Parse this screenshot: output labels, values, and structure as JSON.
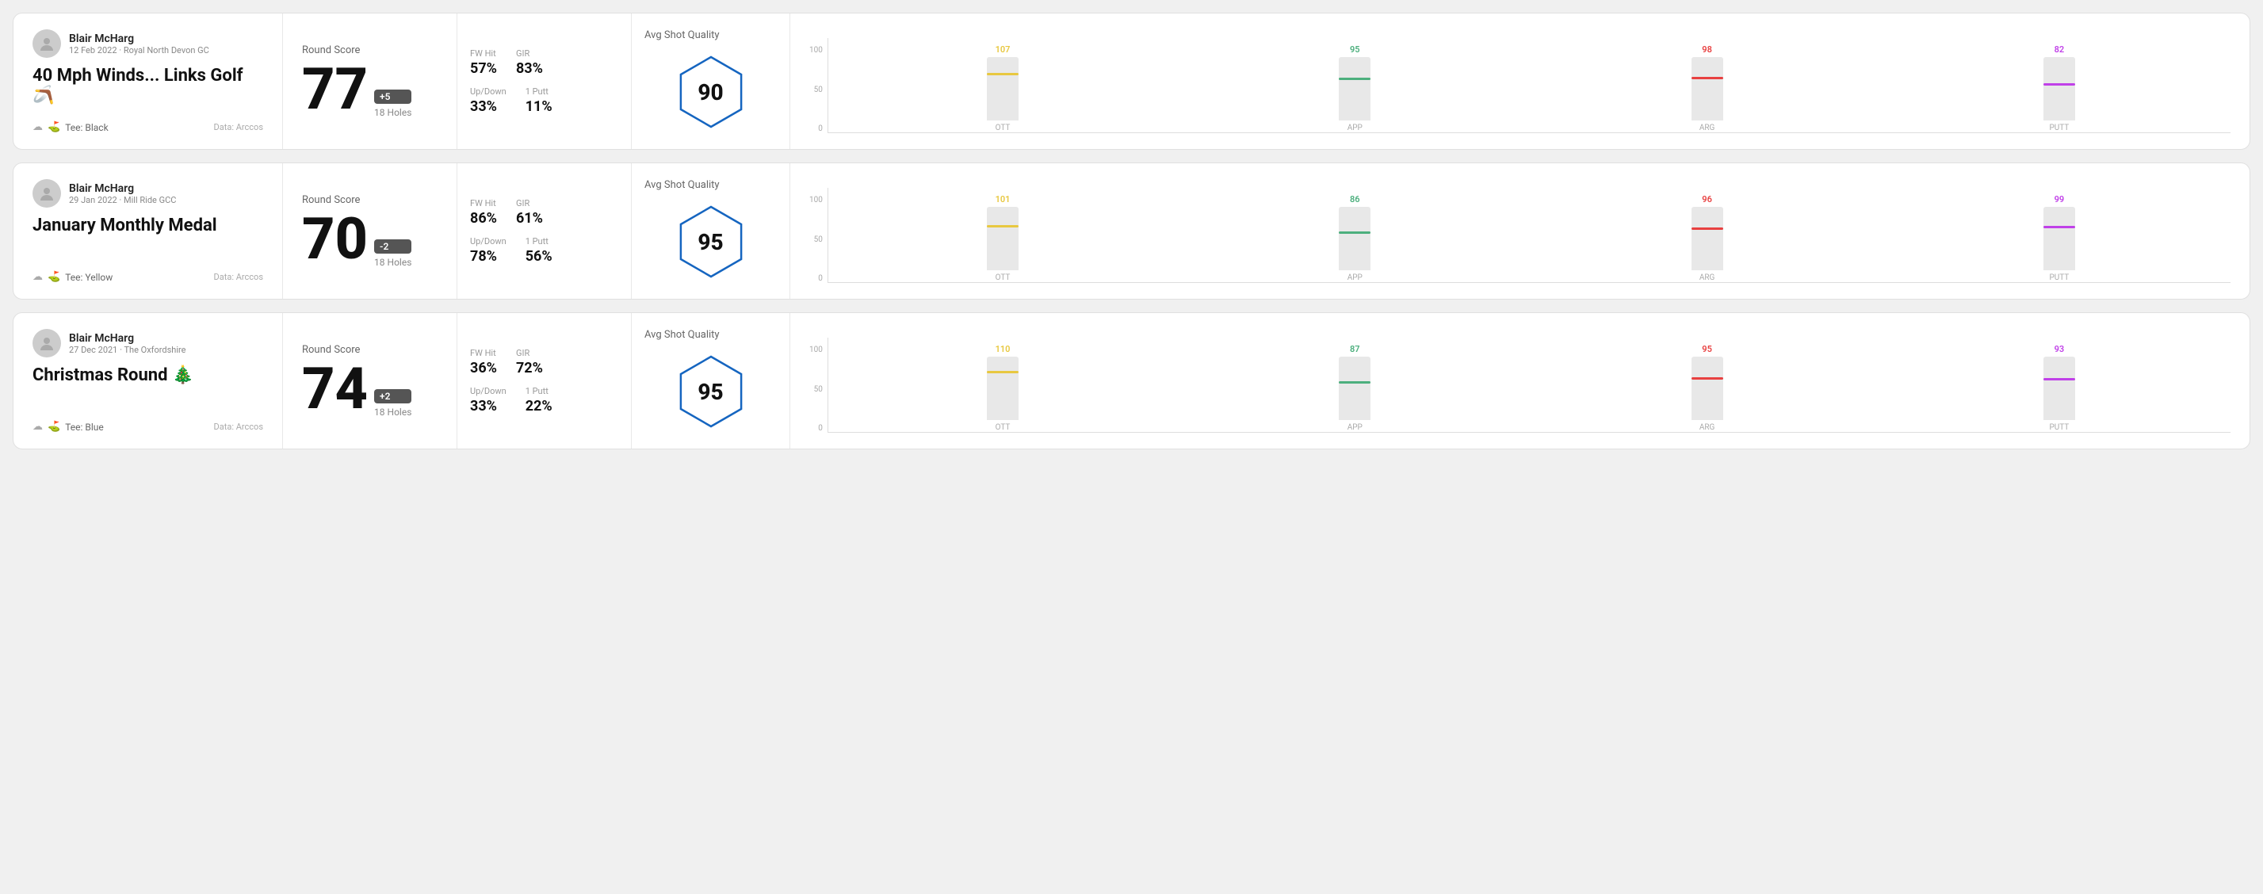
{
  "rounds": [
    {
      "id": "round1",
      "user_name": "Blair McHarg",
      "user_meta": "12 Feb 2022 · Royal North Devon GC",
      "title": "40 Mph Winds... Links Golf 🪃",
      "tee": "Black",
      "data_source": "Data: Arccos",
      "round_score_label": "Round Score",
      "score": "77",
      "badge": "+5",
      "holes": "18 Holes",
      "fw_hit_label": "FW Hit",
      "fw_hit": "57%",
      "gir_label": "GIR",
      "gir": "83%",
      "updown_label": "Up/Down",
      "updown": "33%",
      "oneputt_label": "1 Putt",
      "oneputt": "11%",
      "quality_label": "Avg Shot Quality",
      "quality_score": "90",
      "bars": [
        {
          "label": "OTT",
          "value": 107,
          "color": "#e8c840",
          "max": 150
        },
        {
          "label": "APP",
          "value": 95,
          "color": "#4caf7d",
          "max": 150
        },
        {
          "label": "ARG",
          "value": 98,
          "color": "#e84040",
          "max": 150
        },
        {
          "label": "PUTT",
          "value": 82,
          "color": "#c040e8",
          "max": 150
        }
      ]
    },
    {
      "id": "round2",
      "user_name": "Blair McHarg",
      "user_meta": "29 Jan 2022 · Mill Ride GCC",
      "title": "January Monthly Medal",
      "tee": "Yellow",
      "data_source": "Data: Arccos",
      "round_score_label": "Round Score",
      "score": "70",
      "badge": "-2",
      "holes": "18 Holes",
      "fw_hit_label": "FW Hit",
      "fw_hit": "86%",
      "gir_label": "GIR",
      "gir": "61%",
      "updown_label": "Up/Down",
      "updown": "78%",
      "oneputt_label": "1 Putt",
      "oneputt": "56%",
      "quality_label": "Avg Shot Quality",
      "quality_score": "95",
      "bars": [
        {
          "label": "OTT",
          "value": 101,
          "color": "#e8c840",
          "max": 150
        },
        {
          "label": "APP",
          "value": 86,
          "color": "#4caf7d",
          "max": 150
        },
        {
          "label": "ARG",
          "value": 96,
          "color": "#e84040",
          "max": 150
        },
        {
          "label": "PUTT",
          "value": 99,
          "color": "#c040e8",
          "max": 150
        }
      ]
    },
    {
      "id": "round3",
      "user_name": "Blair McHarg",
      "user_meta": "27 Dec 2021 · The Oxfordshire",
      "title": "Christmas Round 🎄",
      "tee": "Blue",
      "data_source": "Data: Arccos",
      "round_score_label": "Round Score",
      "score": "74",
      "badge": "+2",
      "holes": "18 Holes",
      "fw_hit_label": "FW Hit",
      "fw_hit": "36%",
      "gir_label": "GIR",
      "gir": "72%",
      "updown_label": "Up/Down",
      "updown": "33%",
      "oneputt_label": "1 Putt",
      "oneputt": "22%",
      "quality_label": "Avg Shot Quality",
      "quality_score": "95",
      "bars": [
        {
          "label": "OTT",
          "value": 110,
          "color": "#e8c840",
          "max": 150
        },
        {
          "label": "APP",
          "value": 87,
          "color": "#4caf7d",
          "max": 150
        },
        {
          "label": "ARG",
          "value": 95,
          "color": "#e84040",
          "max": 150
        },
        {
          "label": "PUTT",
          "value": 93,
          "color": "#c040e8",
          "max": 150
        }
      ]
    }
  ],
  "chart_y_labels": [
    "100",
    "50",
    "0"
  ]
}
